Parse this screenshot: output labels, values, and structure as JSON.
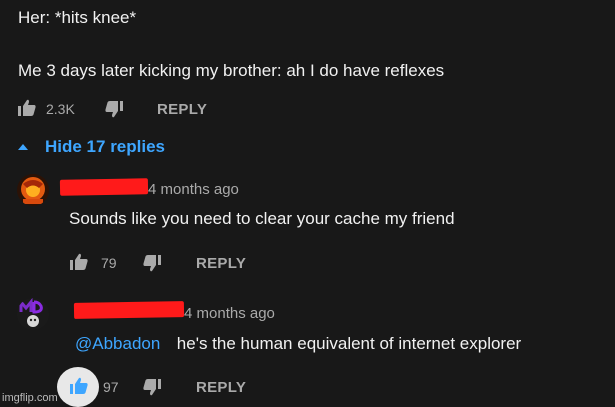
{
  "comment": {
    "line1": "Her: *hits knee*",
    "line2": "Me 3 days later kicking my brother: ah I do have reflexes",
    "like_count": "2.3K",
    "reply_label": "REPLY",
    "like_icon": "thumbs-up-icon",
    "dislike_icon": "thumbs-down-icon"
  },
  "replies_toggle": {
    "label": "Hide 17 replies",
    "icon": "caret-up-icon"
  },
  "replies": [
    {
      "time": "4 months ago",
      "text": "Sounds like you need to clear your cache my friend",
      "like_count": "79",
      "reply_label": "REPLY"
    },
    {
      "time": "4 months ago",
      "mention": "@Abbadon",
      "text": "he's the human equivalent of internet explorer",
      "like_count": "97",
      "reply_label": "REPLY",
      "liked": true
    }
  ],
  "watermark": "imgflip.com",
  "colors": {
    "background": "#181818",
    "text": "#f1f1f1",
    "muted": "#aaaaaa",
    "link": "#3ea6ff",
    "redaction": "#ff1a1a"
  }
}
